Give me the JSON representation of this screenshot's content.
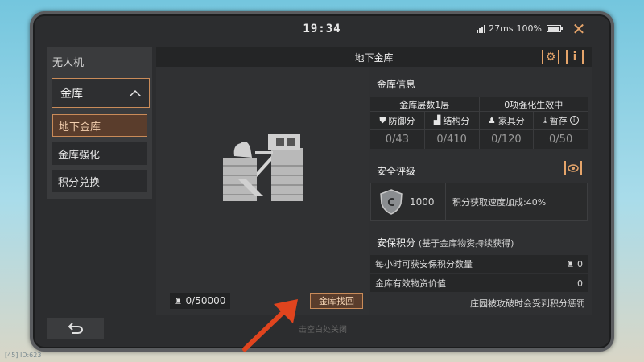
{
  "status": {
    "time": "19:34",
    "ping": "27ms",
    "battery": "100%"
  },
  "sidebar": {
    "drone": "无人机",
    "vault": "金库",
    "items": [
      {
        "label": "地下金库"
      },
      {
        "label": "金库强化"
      },
      {
        "label": "积分兑换"
      }
    ]
  },
  "main": {
    "title": "地下金库",
    "capacity": "0/50000",
    "retrieve": "金库找回"
  },
  "vault_info": {
    "title": "金库信息",
    "floors": "金库层数1层",
    "enhance": "0项强化生效中",
    "stats": [
      {
        "label": "防御分",
        "value": "0/43",
        "icon": "shield-small-icon"
      },
      {
        "label": "结构分",
        "value": "0/410",
        "icon": "structure-icon"
      },
      {
        "label": "家具分",
        "value": "0/120",
        "icon": "furniture-icon"
      },
      {
        "label": "暂存",
        "value": "0/50",
        "icon": "download-icon"
      }
    ]
  },
  "security": {
    "title": "安全评级",
    "grade": "C",
    "value": "1000",
    "bonus": "积分获取速度加成:40%"
  },
  "points": {
    "title": "安保积分",
    "subtitle": "(基于金库物资持续获得)",
    "hourly_label": "每小时可获安保积分数量",
    "hourly_value": "0",
    "valid_label": "金库有效物资价值",
    "valid_value": "0",
    "penalty": "庄园被攻破时会受到积分惩罚"
  },
  "overlay": {
    "hint": "击空白处关闭"
  },
  "debug": "[45] ID:623",
  "colors": {
    "accent": "#e5a46a",
    "arrow": "#e0441e"
  }
}
